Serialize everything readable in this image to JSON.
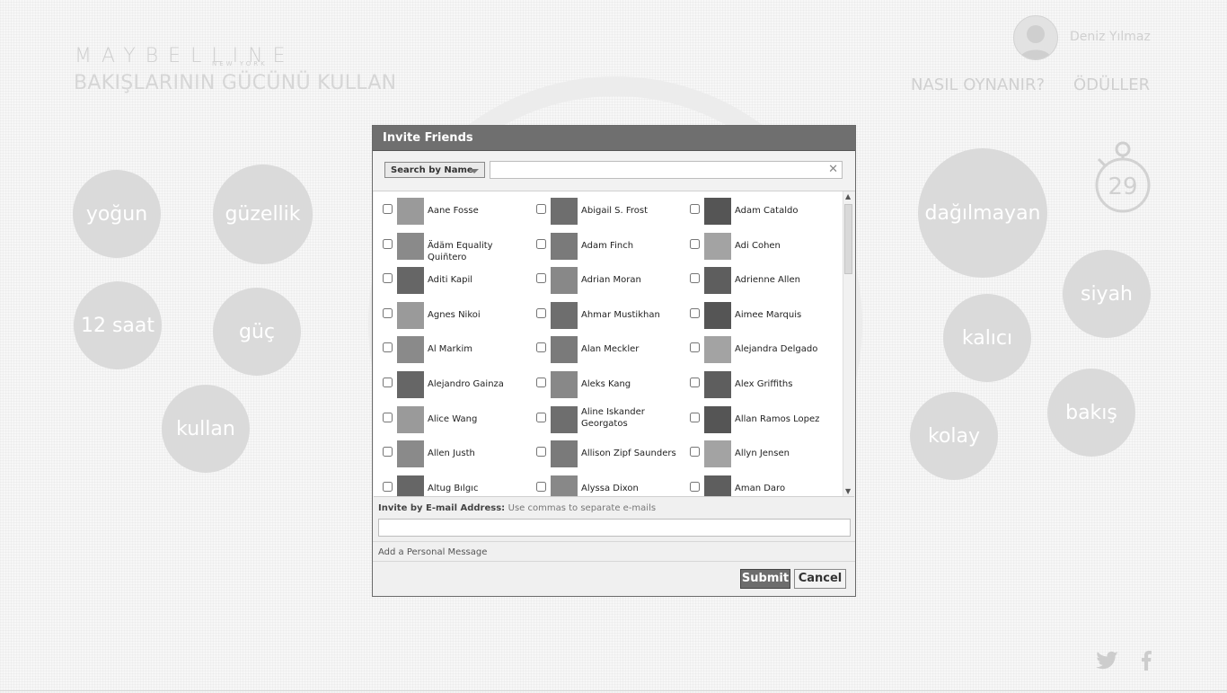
{
  "brand": {
    "logo": "MAYBELLINE",
    "sub": "NEW YORK",
    "tagline": "BAKIŞLARININ GÜCÜNÜ KULLAN"
  },
  "user": {
    "name": "Deniz Yılmaz"
  },
  "nav": {
    "how_to_play": "NASIL OYNANIR?",
    "rewards": "ÖDÜLLER"
  },
  "timer": {
    "value": "29"
  },
  "bubbles": [
    "yoğun",
    "güzellik",
    "12 saat",
    "güç",
    "kullan",
    "dağılmayan",
    "siyah",
    "kalıcı",
    "bakış",
    "kolay"
  ],
  "dialog": {
    "title": "Invite Friends",
    "search_mode": "Search by Name",
    "search_value": "",
    "friends": [
      "Aane Fosse",
      "Abigail S. Frost",
      "Adam Cataldo",
      "Ädäm Equality Quiñtero",
      "Adam Finch",
      "Adi Cohen",
      "Aditi Kapil",
      "Adrian Moran",
      "Adrienne Allen",
      "Agnes Nikoi",
      "Ahmar Mustikhan",
      "Aimee Marquis",
      "Al Markim",
      "Alan Meckler",
      "Alejandra Delgado",
      "Alejandro Gainza",
      "Aleks Kang",
      "Alex Griffiths",
      "Alice Wang",
      "Aline Iskander Georgatos",
      "Allan Ramos Lopez",
      "Allen Justh",
      "Allison Zipf Saunders",
      "Allyn Jensen",
      "Altug Bılgıc",
      "Alyssa Dixon",
      "Aman Daro"
    ],
    "email_label": "Invite by E-mail Address:",
    "email_hint": "Use commas to separate e-mails",
    "email_value": "",
    "personal_message": "Add a Personal Message",
    "submit_label": "Submit",
    "cancel_label": "Cancel"
  },
  "social": {
    "twitter_icon": "twitter-icon",
    "facebook_icon": "facebook-icon"
  }
}
